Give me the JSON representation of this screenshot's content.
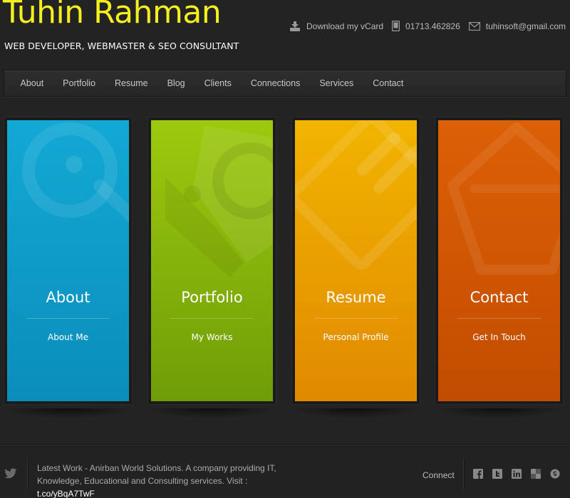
{
  "header": {
    "title": "Tuhin Rahman",
    "tagline": "WEB DEVELOPER, WEBMASTER & SEO CONSULTANT",
    "title_color": "#f5ef1f",
    "contacts": [
      {
        "icon": "download-icon",
        "text": "Download my vCard"
      },
      {
        "icon": "phone-icon",
        "text": "01713.462826"
      },
      {
        "icon": "mail-icon",
        "text": "tuhinsoft@gmail.com"
      }
    ]
  },
  "nav": {
    "items": [
      "About",
      "Portfolio",
      "Resume",
      "Blog",
      "Clients",
      "Connections",
      "Services",
      "Contact"
    ]
  },
  "tiles": [
    {
      "title": "About",
      "subtitle": "About Me",
      "color": "#12a9d4"
    },
    {
      "title": "Portfolio",
      "subtitle": "My Works",
      "color": "#9dc90e"
    },
    {
      "title": "Resume",
      "subtitle": "Personal Profile",
      "color": "#f2b400"
    },
    {
      "title": "Contact",
      "subtitle": "Get In Touch",
      "color": "#dc6006"
    }
  ],
  "footer": {
    "latest_text": "Latest Work - Anirban World Solutions. A company providing IT, Knowledge, Educational and Consulting services. Visit : ",
    "latest_link": "t.co/yBqA7TwF",
    "connect_label": "Connect",
    "social_icons": [
      "facebook-icon",
      "twitter-icon",
      "linkedin-icon",
      "delicious-icon",
      "skype-icon"
    ]
  }
}
